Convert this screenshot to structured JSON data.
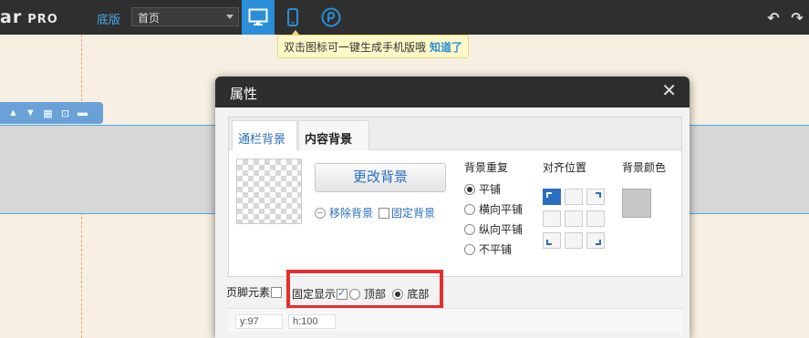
{
  "topbar": {
    "logo": "ar",
    "logo_pro": "PRO",
    "base_label": "底版",
    "page_select": "首页",
    "undo": "↶",
    "redo": "↷"
  },
  "tooltip": {
    "text": "双击图标可一键生成手机版哦",
    "link": "知道了"
  },
  "dialog": {
    "title": "属性",
    "close": "✕",
    "tabs": [
      {
        "label": "通栏背景"
      },
      {
        "label": "内容背景"
      }
    ],
    "change_bg_button": "更改背景",
    "remove_bg": "移除背景",
    "fixed_bg": "固定背景",
    "repeat_title": "背景重复",
    "repeat_options": [
      "平铺",
      "横向平铺",
      "纵向平铺",
      "不平铺"
    ],
    "repeat_selected": "平铺",
    "align_title": "对齐位置",
    "color_title": "背景颜色",
    "bg_color": "#c8c8c8",
    "footer_label": "页脚元素",
    "fixed_display_label": "固定显示",
    "fixed_display_options": [
      "顶部",
      "底部"
    ],
    "fixed_display_selected": "底部",
    "y_value": "y:97",
    "h_value": "h:100"
  },
  "colors": {
    "accent": "#2a8fd8",
    "highlight_border": "#e62e2e",
    "toolbar_bg": "#2f2f2f"
  }
}
